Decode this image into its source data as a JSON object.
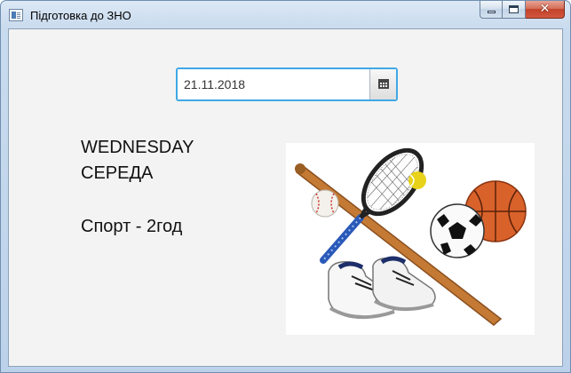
{
  "window": {
    "title": "Підготовка до ЗНО",
    "controls": {
      "minimize": "minimize-icon",
      "maximize": "maximize-icon",
      "close": "✕"
    }
  },
  "date_picker": {
    "value": "21.11.2018",
    "button_icon": "calendar-icon"
  },
  "content": {
    "day_en": "WEDNESDAY",
    "day_ua": "СЕРЕДА",
    "activity": "Спорт - 2год"
  },
  "image": {
    "subject": "sports-equipment",
    "colors": {
      "basketball": "#d9622b",
      "bat": "#c47a34",
      "racket_handle": "#2a59b8",
      "tennis_ball": "#e8d21a"
    }
  }
}
